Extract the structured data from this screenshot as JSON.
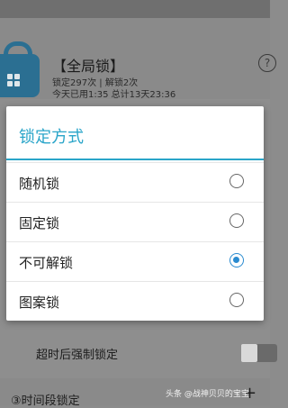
{
  "app": {
    "title": "【全局锁】",
    "stats_line1": "锁定297次 | 解锁2次",
    "stats_line2": "今天已用1:35 总计13天23:36",
    "help": "?"
  },
  "bottom": {
    "force_lock_label": "超时后强制锁定",
    "next_item_label": "③时间段锁定",
    "add": "+"
  },
  "watermark": "头条 @战神贝贝的宝宝",
  "dialog": {
    "title": "锁定方式",
    "options": [
      {
        "label": "随机锁",
        "selected": false
      },
      {
        "label": "固定锁",
        "selected": false
      },
      {
        "label": "不可解锁",
        "selected": true
      },
      {
        "label": "图案锁",
        "selected": false
      }
    ]
  },
  "colors": {
    "accent": "#2aa5c9",
    "radio_selected": "#2a8bd0",
    "app_icon": "#2b6f92"
  }
}
